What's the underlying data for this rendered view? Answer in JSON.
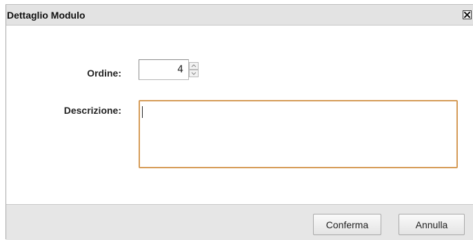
{
  "dialog": {
    "title": "Dettaglio Modulo",
    "close_icon": "close-icon"
  },
  "form": {
    "ordine_label": "Ordine:",
    "ordine_value": "4",
    "descrizione_label": "Descrizione:",
    "descrizione_value": ""
  },
  "footer": {
    "confirm_label": "Conferma",
    "cancel_label": "Annulla"
  },
  "colors": {
    "titlebar_bg": "#e3e3e3",
    "focus_border": "#d59a55",
    "footer_bg": "#e6e6e6"
  }
}
